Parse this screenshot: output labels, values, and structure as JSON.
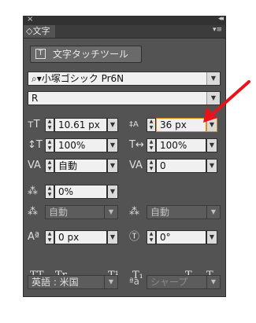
{
  "panel": {
    "tab_label": "◇文字",
    "close": "×",
    "collapse": "◂◂",
    "menu": "▾≡"
  },
  "touch_button": {
    "label": "文字タッチツール"
  },
  "font": {
    "family": "小塚ゴシック Pr6N",
    "style": "R"
  },
  "size": {
    "value": "10.61 px"
  },
  "leading": {
    "value": "36 px"
  },
  "vscale": {
    "value": "100%"
  },
  "hscale": {
    "value": "100%"
  },
  "kerning": {
    "value": "自動"
  },
  "tracking": {
    "value": "0"
  },
  "tsume": {
    "value": "0%"
  },
  "aki_left": {
    "value": "自動"
  },
  "aki_right": {
    "value": "自動"
  },
  "baseline": {
    "value": "0 px"
  },
  "rotation": {
    "value": "0°"
  },
  "language": {
    "value": "英語 : 米国"
  },
  "antialias": {
    "value": "シャープ"
  },
  "format_buttons": {
    "tt": "TT",
    "tr": "Tr",
    "sup": "T¹",
    "sub": "T₁",
    "under": "T",
    "strike": "T"
  },
  "colors": {
    "panel_bg": "#535353",
    "highlight": "#e08a1e",
    "arrow": "#e8131b"
  }
}
